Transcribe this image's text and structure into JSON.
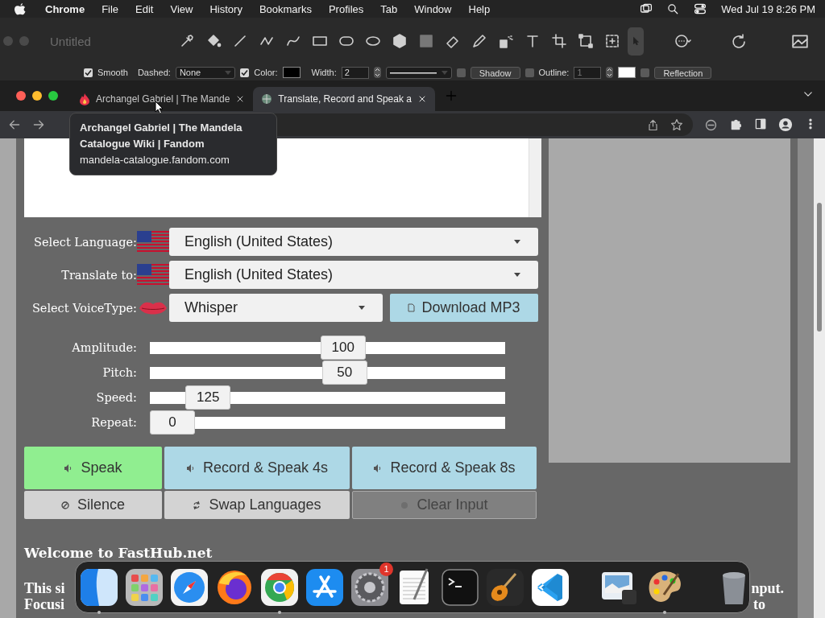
{
  "menu_bar": {
    "app": "Chrome",
    "items": [
      "File",
      "Edit",
      "View",
      "History",
      "Bookmarks",
      "Profiles",
      "Tab",
      "Window",
      "Help"
    ],
    "clock": "Wed Jul 19  8:26 PM"
  },
  "paint_app": {
    "title": "Untitled",
    "smooth": {
      "label": "Smooth",
      "checked": true
    },
    "dashed": {
      "label": "Dashed:",
      "value": "None"
    },
    "color": {
      "label": "Color:",
      "checked": true
    },
    "width": {
      "label": "Width:",
      "value": "2"
    },
    "shadow": {
      "label": "Shadow",
      "checked": false
    },
    "outline": {
      "label": "Outline:",
      "value": "1",
      "checked": false
    },
    "reflection": {
      "label": "Reflection",
      "checked": false
    }
  },
  "browser": {
    "tabs": [
      {
        "title": "Archangel Gabriel | The Mande",
        "selected": false
      },
      {
        "title": "Translate, Record and Speak a",
        "selected": true
      }
    ],
    "tooltip": {
      "title": "Archangel Gabriel | The Mandela Catalogue Wiki | Fandom",
      "url": "mandela-catalogue.fandom.com"
    }
  },
  "form": {
    "language": {
      "label": "Select Language:",
      "value": "English (United States)"
    },
    "translate": {
      "label": "Translate to:",
      "value": "English (United States)"
    },
    "voice": {
      "label": "Select VoiceType:",
      "value": "Whisper"
    },
    "download": "Download MP3",
    "sliders": [
      {
        "label": "Amplitude:",
        "value": "100",
        "level": 0.55
      },
      {
        "label": "Pitch:",
        "value": "50",
        "level": 0.555
      },
      {
        "label": "Speed:",
        "value": "125",
        "level": 0.115
      },
      {
        "label": "Repeat:",
        "value": "0",
        "level": 0
      }
    ],
    "buttons": [
      {
        "kind": "speak",
        "label": "Speak",
        "disabled": false
      },
      {
        "kind": "record",
        "label": "Record & Speak 4s",
        "disabled": false
      },
      {
        "kind": "record",
        "label": "Record & Speak 8s",
        "disabled": false
      },
      {
        "kind": "silence",
        "label": "Silence",
        "disabled": false
      },
      {
        "kind": "swap",
        "label": "Swap Languages",
        "disabled": false
      },
      {
        "kind": "clear",
        "label": "Clear Input",
        "disabled": true
      }
    ]
  },
  "welcome": {
    "heading": "Welcome to FastHub.net",
    "line1_start": "This si",
    "line1_end": "nput.",
    "line2_start": "Focusi",
    "line2_end": "to"
  },
  "dock": [
    {
      "kind": "finder",
      "running": true
    },
    {
      "kind": "launchpad",
      "running": false
    },
    {
      "kind": "compass",
      "running": false
    },
    {
      "kind": "fox",
      "running": false
    },
    {
      "kind": "browser",
      "running": true
    },
    {
      "kind": "store",
      "running": false
    },
    {
      "kind": "settings",
      "running": false,
      "badge": "1"
    },
    {
      "kind": "notepad",
      "running": false
    },
    {
      "kind": "terminal",
      "running": false
    },
    {
      "kind": "guitar",
      "running": false
    },
    {
      "kind": "code",
      "running": false
    },
    {
      "kind": "separator"
    },
    {
      "kind": "preview",
      "running": false
    },
    {
      "kind": "palette",
      "running": true
    },
    {
      "kind": "separator"
    },
    {
      "kind": "trash",
      "running": false
    }
  ]
}
